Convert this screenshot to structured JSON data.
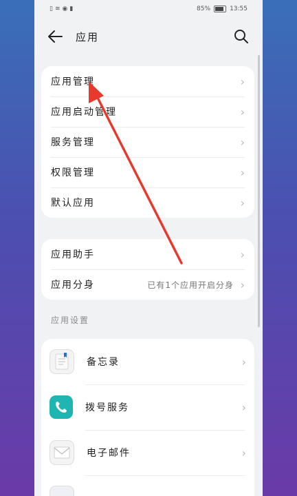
{
  "status": {
    "battery_pct": "85%",
    "time": "13:55"
  },
  "header": {
    "title": "应用"
  },
  "group1": {
    "items": [
      {
        "label": "应用管理"
      },
      {
        "label": "应用启动管理"
      },
      {
        "label": "服务管理"
      },
      {
        "label": "权限管理"
      },
      {
        "label": "默认应用"
      }
    ]
  },
  "group2": {
    "items": [
      {
        "label": "应用助手"
      },
      {
        "label": "应用分身",
        "value": "已有1个应用开启分身"
      }
    ]
  },
  "settings": {
    "section_label": "应用设置",
    "apps": [
      {
        "label": "备忘录",
        "icon": "memo-icon"
      },
      {
        "label": "拨号服务",
        "icon": "phone-icon"
      },
      {
        "label": "电子邮件",
        "icon": "email-icon"
      },
      {
        "label": "",
        "icon": "app-icon"
      }
    ]
  },
  "colors": {
    "accent_arrow": "#e8392e",
    "phone_teal": "#1fb5b0"
  }
}
